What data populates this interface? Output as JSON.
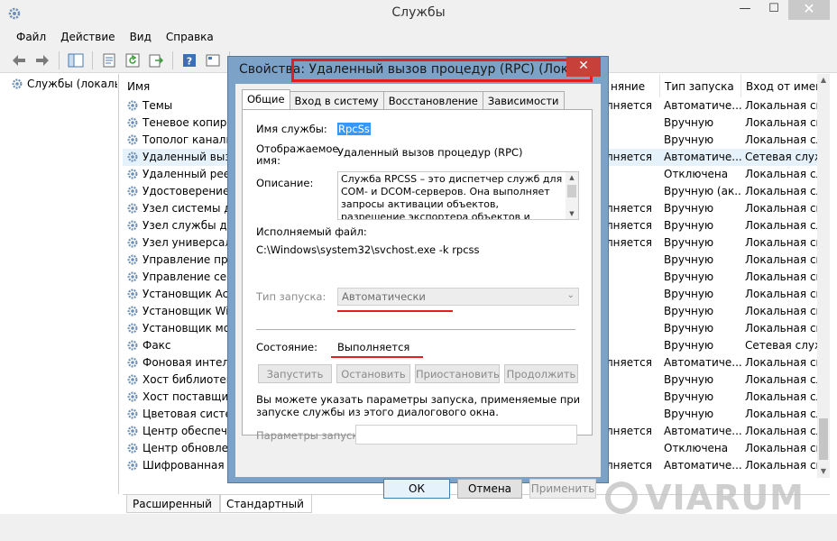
{
  "window": {
    "title": "Службы",
    "min_glyph": "—",
    "max_glyph": "☐",
    "close_glyph": "✕"
  },
  "menu": [
    "Файл",
    "Действие",
    "Вид",
    "Справка"
  ],
  "toolbar": {
    "icons": [
      "back-arrow-icon",
      "forward-arrow-icon",
      "console-tree-icon",
      "properties-icon",
      "refresh-icon",
      "export-icon",
      "help-icon",
      "view-icon",
      "play-icon"
    ]
  },
  "tree": {
    "root_label": "Службы (локаль"
  },
  "columns": {
    "name": "Имя",
    "state": "няние",
    "startup": "Тип запуска",
    "logon": "Вход от имени"
  },
  "services": [
    {
      "name": "Темы",
      "state": "лняется",
      "startup": "Автоматиче...",
      "logon": "Локальная сис"
    },
    {
      "name": "Теневое копирова",
      "state": "",
      "startup": "Вручную",
      "logon": "Локальная сис"
    },
    {
      "name": "Тополог канально",
      "state": "",
      "startup": "Вручную",
      "logon": "Локальная сл"
    },
    {
      "name": "Удаленный вызов",
      "state": "лняется",
      "startup": "Автоматиче...",
      "logon": "Сетевая служ"
    },
    {
      "name": "Удаленный реестр",
      "state": "",
      "startup": "Отключена",
      "logon": "Локальная сл"
    },
    {
      "name": "Удостоверение пр",
      "state": "",
      "startup": "Вручную (ак...",
      "logon": "Локальная сл"
    },
    {
      "name": "Узел системы диа",
      "state": "лняется",
      "startup": "Вручную",
      "logon": "Локальная сис"
    },
    {
      "name": "Узел службы диаг",
      "state": "лняется",
      "startup": "Вручную",
      "logon": "Локальная сл"
    },
    {
      "name": "Узел универсальн",
      "state": "лняется",
      "startup": "Вручную",
      "logon": "Локальная сис"
    },
    {
      "name": "Управление прил",
      "state": "",
      "startup": "Вручную",
      "logon": "Локальная сис"
    },
    {
      "name": "Управление серти",
      "state": "",
      "startup": "Вручную",
      "logon": "Локальная сис"
    },
    {
      "name": "Установщик Active",
      "state": "",
      "startup": "Вручную",
      "logon": "Локальная сис"
    },
    {
      "name": "Установщик Windo",
      "state": "",
      "startup": "Вручную",
      "logon": "Локальная сис"
    },
    {
      "name": "Установщик моду",
      "state": "",
      "startup": "Вручную",
      "logon": "Локальная сис"
    },
    {
      "name": "Факс",
      "state": "",
      "startup": "Вручную",
      "logon": "Сетевая служ"
    },
    {
      "name": "Фоновая интелле",
      "state": "лняется",
      "startup": "Автоматиче...",
      "logon": "Локальная сис"
    },
    {
      "name": "Хост библиотеки",
      "state": "",
      "startup": "Вручную",
      "logon": "Локальная сл"
    },
    {
      "name": "Хост поставщика",
      "state": "",
      "startup": "Вручную",
      "logon": "Локальная сл"
    },
    {
      "name": "Цветовая система",
      "state": "",
      "startup": "Вручную",
      "logon": "Локальная сл"
    },
    {
      "name": "Центр обеспечен",
      "state": "лняется",
      "startup": "Автоматиче...",
      "logon": "Локальная сл"
    },
    {
      "name": "Центр обновлени",
      "state": "",
      "startup": "Отключена",
      "logon": "Локальная сис"
    },
    {
      "name": "Шифрованная фа",
      "state": "лняется",
      "startup": "Автоматиче...",
      "logon": "Локальная сис"
    }
  ],
  "bottom_tabs": [
    "Расширенный",
    "Стандартный"
  ],
  "dialog": {
    "title": "Свойства: Удаленный вызов процедур (RPC) (Локал...",
    "close_glyph": "✕",
    "tabs": [
      "Общие",
      "Вход в систему",
      "Восстановление",
      "Зависимости"
    ],
    "service_name_label": "Имя службы:",
    "service_name": "RpcSs",
    "display_name_label_1": "Отображаемое",
    "display_name_label_2": "имя:",
    "display_name": "Удаленный вызов процедур (RPC)",
    "description_label": "Описание:",
    "description": "Служба RPCSS – это диспетчер служб для COM- и DCOM-серверов. Она выполняет запросы активации объектов, разрешение экспортера объектов и распределенный сбор мусора для",
    "exe_label": "Исполняемый файл:",
    "exe_path": "C:\\Windows\\system32\\svchost.exe -k rpcss",
    "startup_type_label": "Тип запуска:",
    "startup_type": "Автоматически",
    "status_label": "Состояние:",
    "status": "Выполняется",
    "buttons": {
      "start": "Запустить",
      "stop": "Остановить",
      "pause": "Приостановить",
      "resume": "Продолжить"
    },
    "hint": "Вы можете указать параметры запуска, применяемые при запуске службы из этого диалогового окна.",
    "params_label": "Параметры запуска:",
    "params_value": "",
    "ok": "ОК",
    "cancel": "Отмена",
    "apply": "Применить"
  },
  "watermark": "VIARUM",
  "colors": {
    "highlight_red": "#e02020",
    "dialog_frame": "#7da2c8",
    "selection": "#3399ff"
  }
}
